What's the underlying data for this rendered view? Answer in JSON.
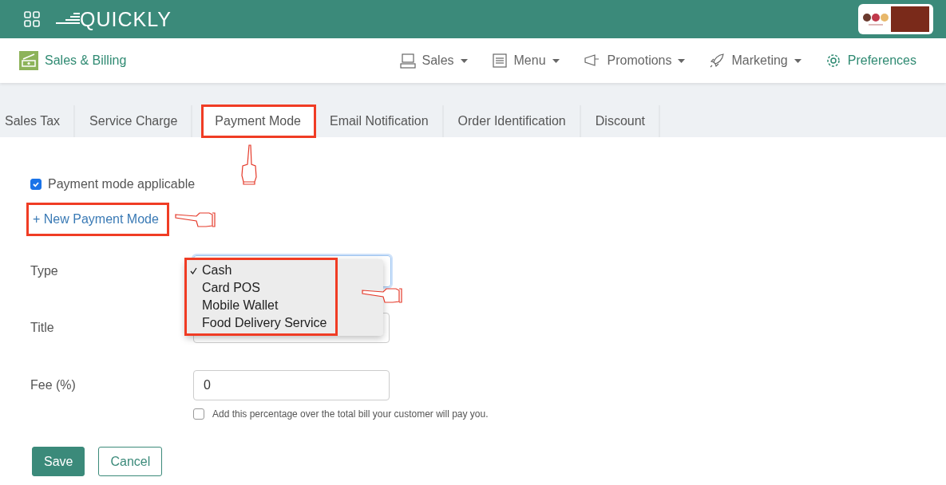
{
  "header": {
    "logo": "QUICKLY"
  },
  "subnav": {
    "section": "Sales & Billing",
    "items": [
      {
        "label": "Sales",
        "dropdown": true,
        "selected": false
      },
      {
        "label": "Menu",
        "dropdown": true,
        "selected": false
      },
      {
        "label": "Promotions",
        "dropdown": true,
        "selected": false
      },
      {
        "label": "Marketing",
        "dropdown": true,
        "selected": false
      },
      {
        "label": "Preferences",
        "dropdown": false,
        "selected": true
      }
    ]
  },
  "tabs": [
    {
      "label": "Sales Tax",
      "selected": false,
      "highlighted": false
    },
    {
      "label": "Service Charge",
      "selected": false,
      "highlighted": false
    },
    {
      "label": "Payment Mode",
      "selected": true,
      "highlighted": true
    },
    {
      "label": "Email Notification",
      "selected": false,
      "highlighted": false
    },
    {
      "label": "Order Identification",
      "selected": false,
      "highlighted": false
    },
    {
      "label": "Discount",
      "selected": false,
      "highlighted": false
    }
  ],
  "applicable": {
    "label": "Payment mode applicable",
    "checked": true
  },
  "new_link": {
    "label": "+ New Payment Mode",
    "highlighted": true
  },
  "form": {
    "type": {
      "label": "Type",
      "highlighted": true,
      "options": [
        {
          "label": "Cash",
          "selected": true
        },
        {
          "label": "Card POS",
          "selected": false
        },
        {
          "label": "Mobile Wallet",
          "selected": false
        },
        {
          "label": "Food Delivery Service",
          "selected": false
        }
      ]
    },
    "title": {
      "label": "Title"
    },
    "fee": {
      "label": "Fee (%)",
      "value": "0",
      "option": {
        "label": "Add this percentage over the total bill your customer will pay you.",
        "checked": false
      }
    }
  },
  "buttons": {
    "save": "Save",
    "cancel": "Cancel"
  }
}
